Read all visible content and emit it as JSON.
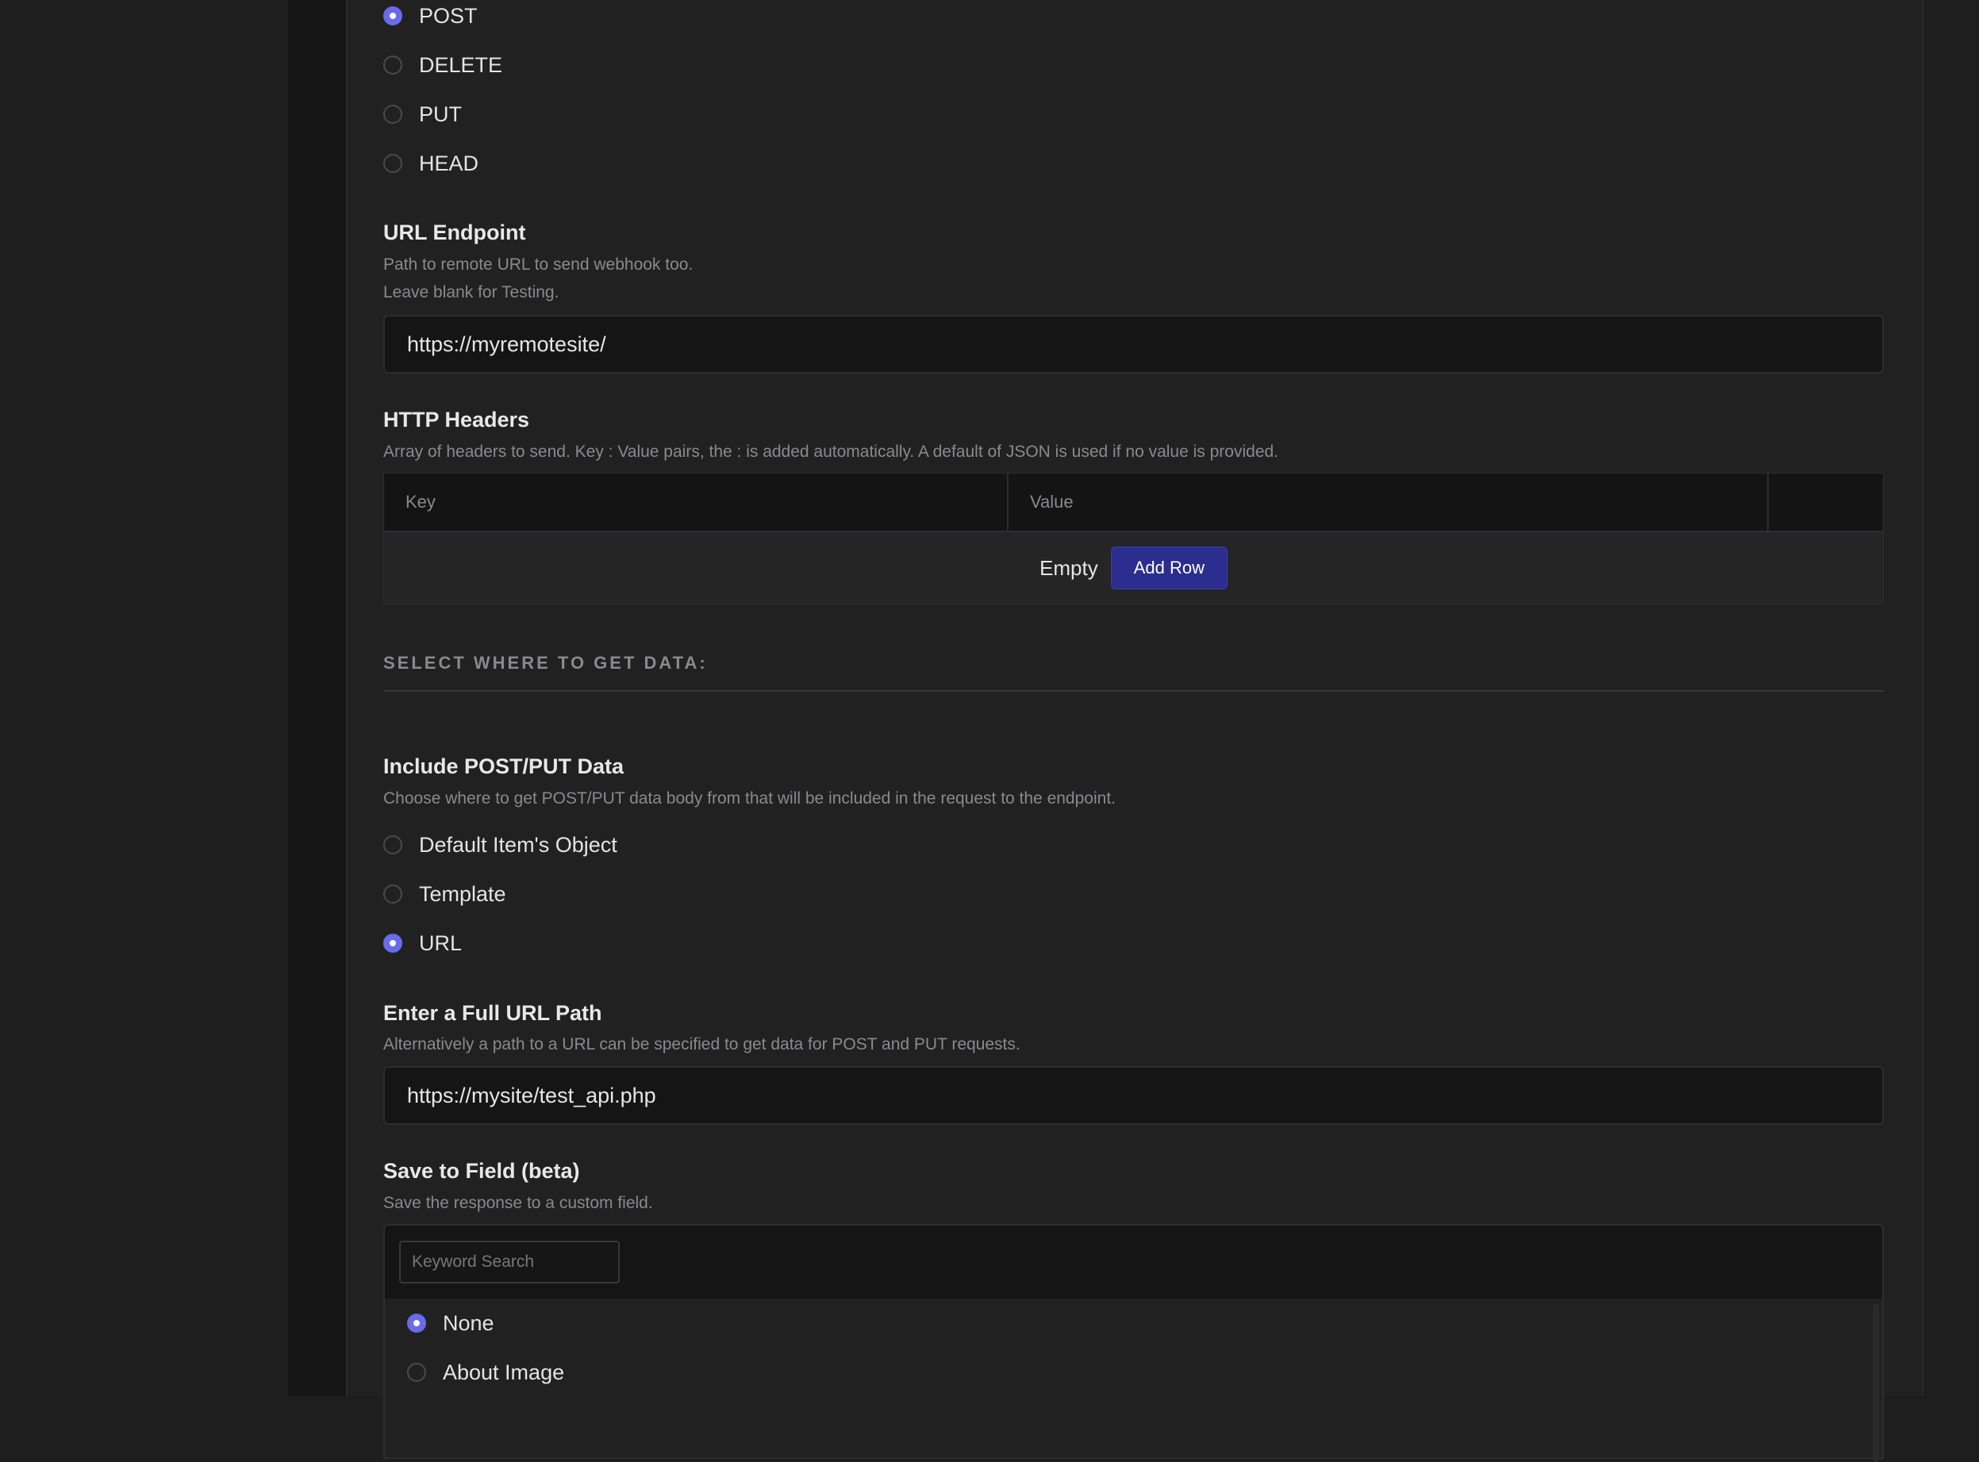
{
  "method_options": [
    {
      "label": "POST",
      "checked": true
    },
    {
      "label": "DELETE",
      "checked": false
    },
    {
      "label": "PUT",
      "checked": false
    },
    {
      "label": "HEAD",
      "checked": false
    }
  ],
  "url_endpoint": {
    "label": "URL Endpoint",
    "help_line1": "Path to remote URL to send webhook too.",
    "help_line2": "Leave blank for Testing.",
    "value": "https://myremotesite/"
  },
  "http_headers": {
    "label": "HTTP Headers",
    "help": "Array of headers to send. Key : Value pairs, the : is added automatically. A default of JSON is used if no value is provided.",
    "col_key": "Key",
    "col_value": "Value",
    "empty_text": "Empty",
    "add_row_label": "Add Row"
  },
  "data_section": {
    "heading": "SELECT WHERE TO GET DATA:"
  },
  "include_data": {
    "label": "Include POST/PUT Data",
    "help": "Choose where to get POST/PUT data body from that will be included in the request to the endpoint.",
    "options": [
      {
        "label": "Default Item's Object",
        "checked": false
      },
      {
        "label": "Template",
        "checked": false
      },
      {
        "label": "URL",
        "checked": true
      }
    ]
  },
  "full_url": {
    "label": "Enter a Full URL Path",
    "help": "Alternatively a path to a URL can be specified to get data for POST and PUT requests.",
    "value": "https://mysite/test_api.php"
  },
  "save_to_field": {
    "label": "Save to Field (beta)",
    "help": "Save the response to a custom field.",
    "search_placeholder": "Keyword Search",
    "options": [
      {
        "label": "None",
        "checked": true
      },
      {
        "label": "About Image",
        "checked": false
      }
    ]
  },
  "colors": {
    "accent": "#6a6bea",
    "button": "#2b2e8e",
    "background": "#212122"
  }
}
